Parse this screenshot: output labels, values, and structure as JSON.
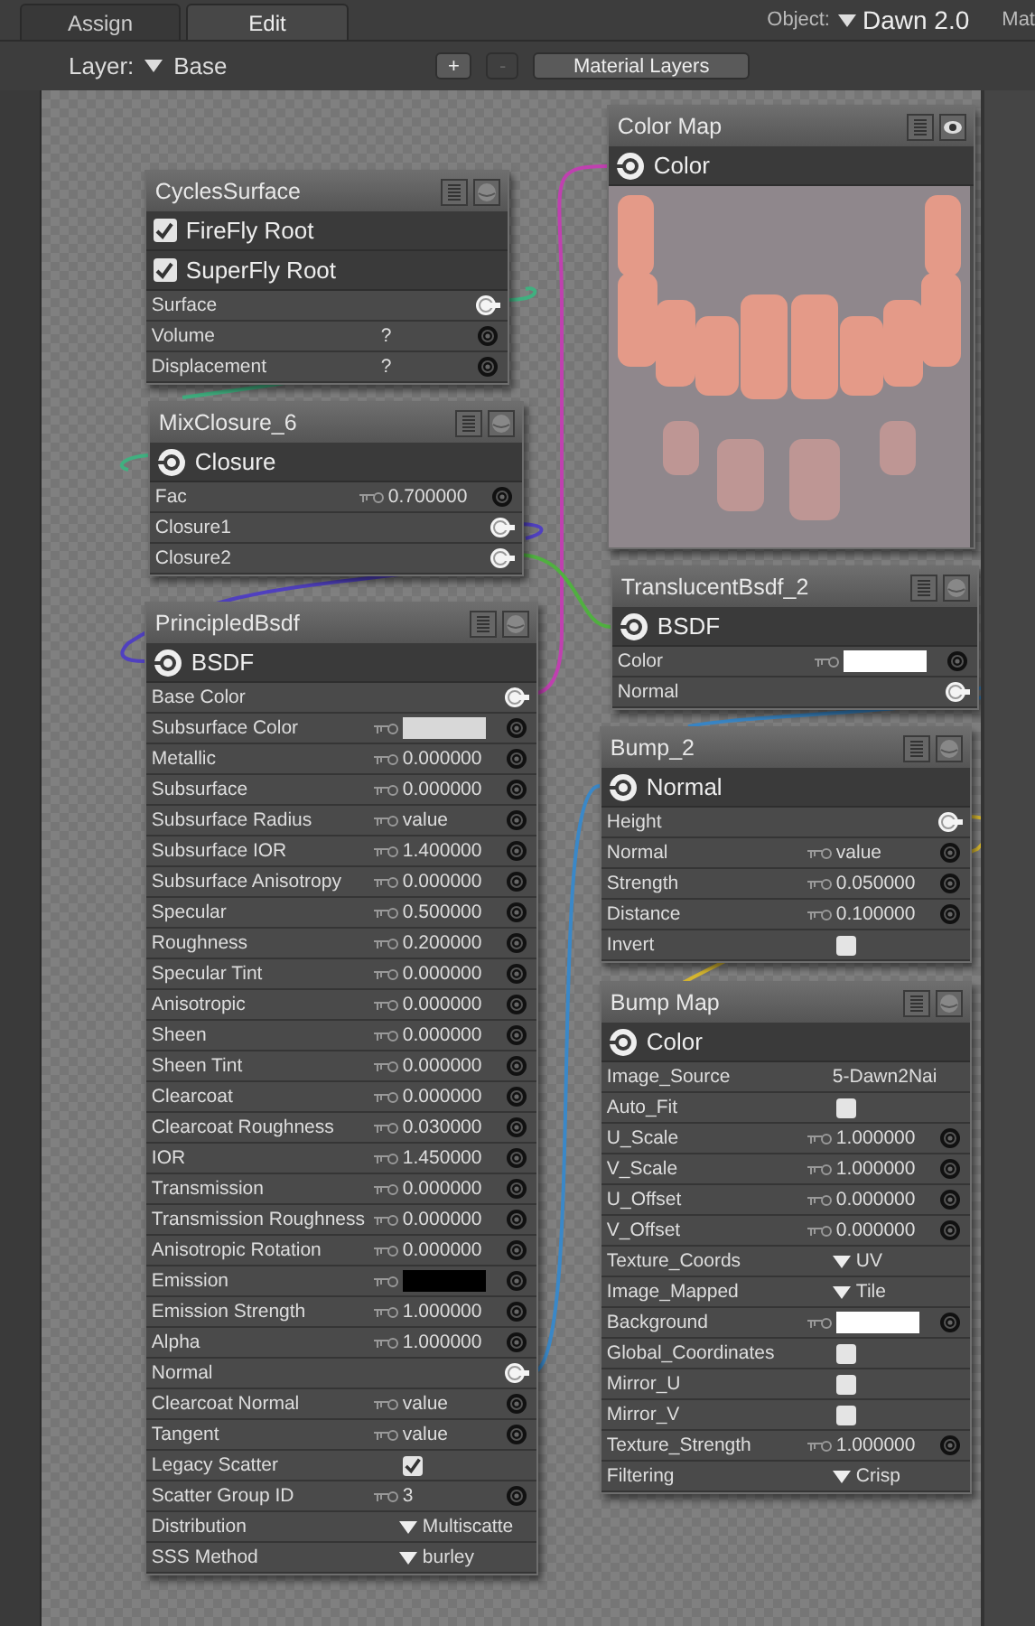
{
  "tabs": [
    {
      "label": "Assign",
      "selected": false
    },
    {
      "label": "Edit",
      "selected": true
    }
  ],
  "object": {
    "label": "Object:",
    "value": "Dawn 2.0"
  },
  "cut_label": "Mat",
  "layer": {
    "label": "Layer:",
    "value": "Base"
  },
  "toolbar": [
    {
      "label": "+",
      "disabled": false
    },
    {
      "label": "-",
      "disabled": true
    },
    {
      "label": "Material Layers",
      "disabled": false
    }
  ],
  "nodes": [
    {
      "title": "CyclesSurface",
      "kind": "shader",
      "rows": [
        {
          "kind": "check",
          "label": "FireFly Root",
          "checked": true
        },
        {
          "kind": "check",
          "label": "SuperFly Root",
          "checked": true
        },
        {
          "kind": "link",
          "label": "Surface"
        },
        {
          "kind": "unset",
          "label": "Volume",
          "value": "?"
        },
        {
          "kind": "unset",
          "label": "Displacement",
          "value": "?"
        }
      ]
    },
    {
      "title": "MixClosure_6",
      "kind": "shader",
      "rows": [
        {
          "kind": "output",
          "label": "Closure"
        },
        {
          "kind": "param",
          "label": "Fac",
          "value": "0.700000"
        },
        {
          "kind": "link",
          "label": "Closure1"
        },
        {
          "kind": "link",
          "label": "Closure2"
        }
      ]
    },
    {
      "title": "PrincipledBsdf",
      "kind": "shader",
      "rows": [
        {
          "kind": "output",
          "label": "BSDF"
        },
        {
          "kind": "link",
          "label": "Base Color"
        },
        {
          "kind": "swatch",
          "label": "Subsurface Color",
          "color": "#d8d8d8"
        },
        {
          "kind": "param",
          "label": "Metallic",
          "value": "0.000000"
        },
        {
          "kind": "param",
          "label": "Subsurface",
          "value": "0.000000"
        },
        {
          "kind": "param",
          "label": "Subsurface Radius",
          "value": "value"
        },
        {
          "kind": "param",
          "label": "Subsurface IOR",
          "value": "1.400000"
        },
        {
          "kind": "param",
          "label": "Subsurface Anisotropy",
          "value": "0.000000"
        },
        {
          "kind": "param",
          "label": "Specular",
          "value": "0.500000"
        },
        {
          "kind": "param",
          "label": "Roughness",
          "value": "0.200000"
        },
        {
          "kind": "param",
          "label": "Specular Tint",
          "value": "0.000000"
        },
        {
          "kind": "param",
          "label": "Anisotropic",
          "value": "0.000000"
        },
        {
          "kind": "param",
          "label": "Sheen",
          "value": "0.000000"
        },
        {
          "kind": "param",
          "label": "Sheen Tint",
          "value": "0.000000"
        },
        {
          "kind": "param",
          "label": "Clearcoat",
          "value": "0.000000"
        },
        {
          "kind": "param",
          "label": "Clearcoat Roughness",
          "value": "0.030000"
        },
        {
          "kind": "param",
          "label": "IOR",
          "value": "1.450000"
        },
        {
          "kind": "param",
          "label": "Transmission",
          "value": "0.000000"
        },
        {
          "kind": "param",
          "label": "Transmission Roughness",
          "value": "0.000000"
        },
        {
          "kind": "param",
          "label": "Anisotropic Rotation",
          "value": "0.000000"
        },
        {
          "kind": "swatch",
          "label": "Emission",
          "color": "#000000"
        },
        {
          "kind": "param",
          "label": "Emission Strength",
          "value": "1.000000"
        },
        {
          "kind": "param",
          "label": "Alpha",
          "value": "1.000000"
        },
        {
          "kind": "link",
          "label": "Normal"
        },
        {
          "kind": "param",
          "label": "Clearcoat Normal",
          "value": "value"
        },
        {
          "kind": "param",
          "label": "Tangent",
          "value": "value"
        },
        {
          "kind": "toggle",
          "label": "Legacy Scatter",
          "checked": true
        },
        {
          "kind": "param",
          "label": "Scatter Group ID",
          "value": "3"
        },
        {
          "kind": "enum",
          "label": "Distribution",
          "value": "Multiscatte"
        },
        {
          "kind": "enum",
          "label": "SSS Method",
          "value": "burley"
        }
      ]
    },
    {
      "title": "Color Map",
      "rows": [
        {
          "kind": "output",
          "label": "Color"
        }
      ]
    },
    {
      "title": "TranslucentBsdf_2",
      "kind": "shader",
      "rows": [
        {
          "kind": "output",
          "label": "BSDF"
        },
        {
          "kind": "swatch",
          "label": "Color",
          "color": "#ffffff"
        },
        {
          "kind": "link",
          "label": "Normal"
        }
      ]
    },
    {
      "title": "Bump_2",
      "kind": "shader",
      "rows": [
        {
          "kind": "output",
          "label": "Normal"
        },
        {
          "kind": "link",
          "label": "Height"
        },
        {
          "kind": "param",
          "label": "Normal",
          "value": "value"
        },
        {
          "kind": "param",
          "label": "Strength",
          "value": "0.050000"
        },
        {
          "kind": "param",
          "label": "Distance",
          "value": "0.100000"
        },
        {
          "kind": "toggle",
          "label": "Invert",
          "checked": false
        }
      ]
    },
    {
      "title": "Bump Map",
      "kind": "shader",
      "rows": [
        {
          "kind": "output",
          "label": "Color"
        },
        {
          "kind": "text",
          "label": "Image_Source",
          "value": "5-Dawn2Nai"
        },
        {
          "kind": "toggle",
          "label": "Auto_Fit",
          "checked": false
        },
        {
          "kind": "param",
          "label": "U_Scale",
          "value": "1.000000"
        },
        {
          "kind": "param",
          "label": "V_Scale",
          "value": "1.000000"
        },
        {
          "kind": "param",
          "label": "U_Offset",
          "value": "0.000000"
        },
        {
          "kind": "param",
          "label": "V_Offset",
          "value": "0.000000"
        },
        {
          "kind": "enum",
          "label": "Texture_Coords",
          "value": "UV"
        },
        {
          "kind": "enum",
          "label": "Image_Mapped",
          "value": "Tile"
        },
        {
          "kind": "swatch",
          "label": "Background",
          "color": "#ffffff"
        },
        {
          "kind": "toggle",
          "label": "Global_Coordinates",
          "checked": false
        },
        {
          "kind": "toggle",
          "label": "Mirror_U",
          "checked": false
        },
        {
          "kind": "toggle",
          "label": "Mirror_V",
          "checked": false
        },
        {
          "kind": "param",
          "label": "Texture_Strength",
          "value": "1.000000"
        },
        {
          "kind": "enum",
          "label": "Filtering",
          "value": "Crisp"
        }
      ]
    }
  ]
}
